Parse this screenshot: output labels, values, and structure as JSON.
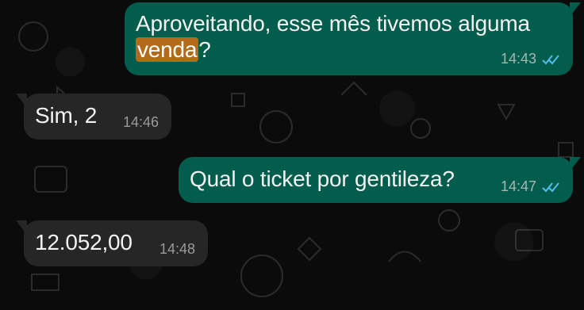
{
  "chat": {
    "messages": [
      {
        "direction": "outgoing",
        "line1": "Aproveitando, esse mês tivemos alguma",
        "highlight": "venda",
        "suffix": "?",
        "time": "14:43",
        "status_icon": "double-check-icon"
      },
      {
        "direction": "incoming",
        "text": "Sim, 2",
        "time": "14:46"
      },
      {
        "direction": "outgoing",
        "text": "Qual o ticket por gentileza?",
        "time": "14:47",
        "status_icon": "double-check-icon"
      },
      {
        "direction": "incoming",
        "text": "12.052,00",
        "time": "14:48"
      }
    ]
  },
  "colors": {
    "background": "#0b0b0b",
    "outgoing_bubble": "#035d4c",
    "incoming_bubble": "#262626",
    "read_tick": "#53bdeb",
    "highlight": "#b36b1a"
  }
}
